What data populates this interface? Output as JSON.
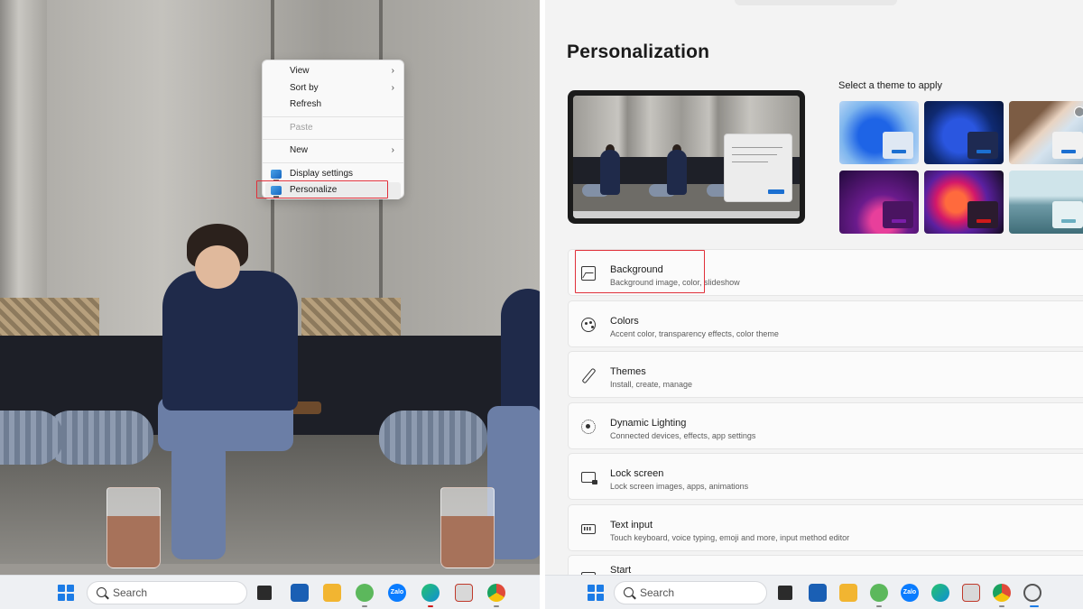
{
  "context_menu": {
    "items": [
      {
        "label": "View",
        "submenu": true
      },
      {
        "label": "Sort by",
        "submenu": true
      },
      {
        "label": "Refresh",
        "submenu": false
      },
      {
        "label": "Paste",
        "disabled": true
      },
      {
        "label": "New",
        "submenu": true
      },
      {
        "label": "Display settings",
        "icon": "display-icon"
      },
      {
        "label": "Personalize",
        "icon": "personalize-icon",
        "highlighted": true
      }
    ]
  },
  "taskbar_left": {
    "search_label": "Search"
  },
  "taskbar_right": {
    "search_label": "Search"
  },
  "taskbar_apps": [
    {
      "name": "task-view-icon",
      "color": "#2b2b2b"
    },
    {
      "name": "microsoft-store-icon",
      "color": "#1a5fb4"
    },
    {
      "name": "file-explorer-icon",
      "color": "#f2b531"
    },
    {
      "name": "coc-coc-browser-icon",
      "color": "#5cb85c"
    },
    {
      "name": "zalo-icon",
      "color": "#0a7cff",
      "text": "Zalo"
    },
    {
      "name": "edge-icon",
      "color": "#0f8fd6"
    },
    {
      "name": "office-app-icon",
      "color": "#d8d8d8"
    },
    {
      "name": "chrome-icon",
      "color": "#e04a3a"
    }
  ],
  "settings": {
    "page_title": "Personalization",
    "themes_label": "Select a theme to apply",
    "themes": [
      {
        "name": "windows-light",
        "accent": "#1b6fd1",
        "mini": "#dfe8f3"
      },
      {
        "name": "windows-dark",
        "accent": "#1b6fd1",
        "mini": "#1e2a52"
      },
      {
        "name": "glow",
        "accent": "#1b6fd1",
        "mini": "#f1f1f1"
      },
      {
        "name": "captured-motion",
        "accent": "#7a1ea8",
        "mini": "#4a1461"
      },
      {
        "name": "flow",
        "accent": "#d01a1a",
        "mini": "#2b1b2e"
      },
      {
        "name": "sunrise",
        "accent": "#6aaec0",
        "mini": "#e6f1f3"
      }
    ],
    "rows": [
      {
        "title": "Background",
        "subtitle": "Background image, color, slideshow"
      },
      {
        "title": "Colors",
        "subtitle": "Accent color, transparency effects, color theme"
      },
      {
        "title": "Themes",
        "subtitle": "Install, create, manage"
      },
      {
        "title": "Dynamic Lighting",
        "subtitle": "Connected devices, effects, app settings"
      },
      {
        "title": "Lock screen",
        "subtitle": "Lock screen images, apps, animations"
      },
      {
        "title": "Text input",
        "subtitle": "Touch keyboard, voice typing, emoji and more, input method editor"
      },
      {
        "title": "Start",
        "subtitle": ""
      }
    ]
  },
  "colors": {
    "highlight_box": "#e0303a",
    "windows_blue": "#1c7ce6"
  }
}
